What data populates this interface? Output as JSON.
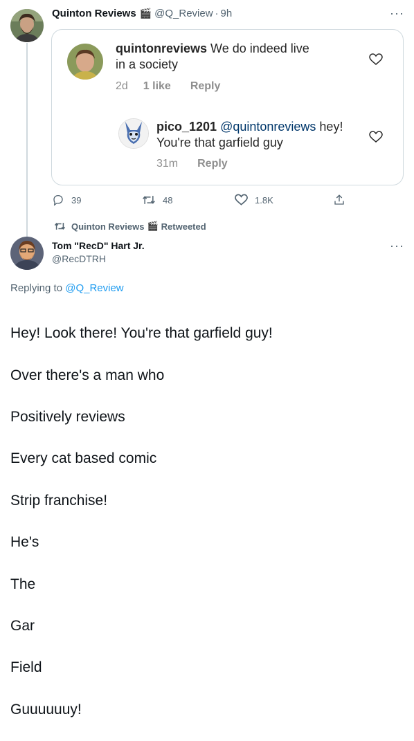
{
  "top_tweet": {
    "display_name": "Quinton Reviews",
    "badge_emoji": "🎬",
    "handle": "@Q_Review",
    "time": "9h",
    "more": "···",
    "embedded_comments": [
      {
        "username": "quintonreviews",
        "text_line1": " We do indeed live",
        "text_line2": "in a society",
        "age": "2d",
        "likes": "1 like",
        "reply_label": "Reply"
      },
      {
        "username": "pico_1201",
        "mention": "@quintonreviews",
        "text_line1": " hey!",
        "text_line2": "You're that garfield guy",
        "age": "31m",
        "reply_label": "Reply"
      }
    ],
    "actions": {
      "replies": "39",
      "retweets": "48",
      "likes": "1.8K"
    }
  },
  "retweet_banner": {
    "name": "Quinton Reviews",
    "emoji": "🎬",
    "suffix": "Retweeted"
  },
  "main_tweet": {
    "display_name": "Tom \"RecD\" Hart Jr.",
    "handle": "@RecDTRH",
    "more": "···",
    "replying_prefix": "Replying to ",
    "replying_to": "@Q_Review",
    "lines": [
      "Hey! Look there! You're that garfield guy!",
      "Over there's a man who",
      "Positively reviews",
      "Every cat based comic",
      "Strip franchise!",
      "He's",
      "The",
      "Gar",
      "Field",
      "Guuuuuuy!"
    ]
  },
  "colors": {
    "accent": "#1d9bf0",
    "muted": "#536471",
    "border": "#cfd9de"
  }
}
